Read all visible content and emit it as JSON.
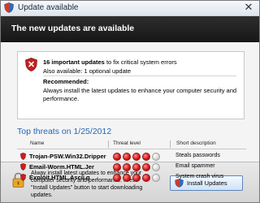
{
  "window": {
    "title": "Update available"
  },
  "header": {
    "text": "The new updates are available"
  },
  "alert": {
    "count_bold": "16 important updates",
    "count_rest": " to fix critical system errors",
    "optional": "Also available: 1 optional update",
    "recommended_heading": "Recommended:",
    "recommended_text": "Always install the latest updates to enhance your computer security and performance."
  },
  "threats": {
    "title": "Top threats on 1/25/2012",
    "columns": {
      "name": "Name",
      "level": "Threat level",
      "desc": "Short description"
    },
    "rows": [
      {
        "name": "Trojan-PSW.Win32.Dripper",
        "level": 4,
        "max_level": 5,
        "description": "Steals passwords"
      },
      {
        "name": "Email-Worm.HTML.Jer",
        "level": 4,
        "max_level": 5,
        "description": "Email spammer"
      },
      {
        "name": "Exploit.HTML.Ascii.g",
        "level": 4,
        "max_level": 5,
        "description": "System crash virus"
      }
    ]
  },
  "footer": {
    "text": "Alway install latest updates to enhance your computer security and performance. Press \"Install Updates\" button to start downloading updates.",
    "install_button": "Install Updates"
  },
  "colors": {
    "accent": "#2667b5",
    "threat_on": "#d21414",
    "header_bg": "#1e1e1e"
  },
  "icons": [
    "shield-icon",
    "close-icon",
    "lock-icon",
    "install-icon"
  ]
}
